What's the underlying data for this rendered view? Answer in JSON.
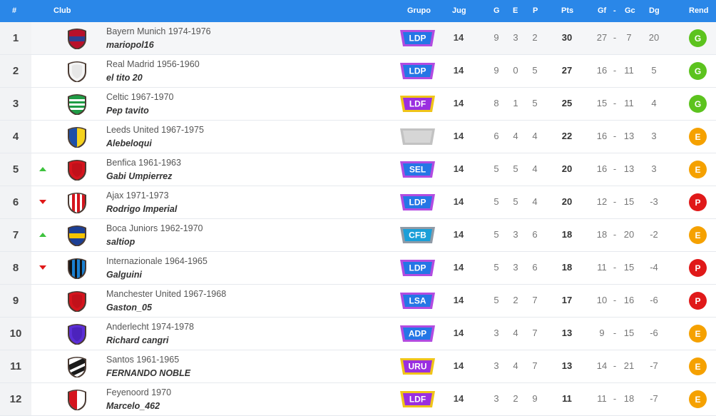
{
  "header": {
    "pos": "#",
    "club": "Club",
    "grupo": "Grupo",
    "jug": "Jug",
    "g": "G",
    "e": "E",
    "p": "P",
    "pts": "Pts",
    "gf": "Gf",
    "sep": "-",
    "gc": "Gc",
    "dg": "Dg",
    "rend": "Rend"
  },
  "colors": {
    "header_bg": "#2a87e8",
    "rend_G": "#5cc31e",
    "rend_E": "#f5a100",
    "rend_P": "#e01919",
    "trend_up": "#3ec23e",
    "trend_down": "#e01919"
  },
  "badge_colors": {
    "LDP": {
      "fill": "#2476e6",
      "rim": "#b24be0"
    },
    "LDF": {
      "fill": "#9a2ee0",
      "rim": "#f0c419"
    },
    "SEL": {
      "fill": "#2476e6",
      "rim": "#b24be0"
    },
    "CFB": {
      "fill": "#1a9fd8",
      "rim": "#8f9aa6"
    },
    "LSA": {
      "fill": "#2476e6",
      "rim": "#b24be0"
    },
    "ADP": {
      "fill": "#2476e6",
      "rim": "#b24be0"
    },
    "URU": {
      "fill": "#9a2ee0",
      "rim": "#f0c419"
    },
    "": {
      "fill": "#d6d6d6",
      "rim": "#c2c2c2"
    }
  },
  "rows": [
    {
      "pos": "1",
      "trend": "",
      "club": "Bayern Munich 1974-1976",
      "manager": "mariopol16",
      "crest": "red-blue-crest-icon",
      "crest_colors": [
        "#b8102a",
        "#2d3f8f"
      ],
      "grupo": "LDP",
      "jug": "14",
      "g": "9",
      "e": "3",
      "p": "2",
      "pts": "30",
      "gf": "27",
      "sep": "-",
      "gc": "7",
      "dg": "20",
      "rend": "G"
    },
    {
      "pos": "2",
      "trend": "",
      "club": "Real Madrid 1956-1960",
      "manager": "el tito 20",
      "crest": "white-crest-icon",
      "crest_colors": [
        "#f4f4f4",
        "#dcdcdc"
      ],
      "grupo": "LDP",
      "jug": "14",
      "g": "9",
      "e": "0",
      "p": "5",
      "pts": "27",
      "gf": "16",
      "sep": "-",
      "gc": "11",
      "dg": "5",
      "rend": "G"
    },
    {
      "pos": "3",
      "trend": "",
      "club": "Celtic 1967-1970",
      "manager": "Pep tavito",
      "crest": "green-hoops-crest-icon",
      "crest_colors": [
        "#1f9b45",
        "#ffffff"
      ],
      "grupo": "LDF",
      "jug": "14",
      "g": "8",
      "e": "1",
      "p": "5",
      "pts": "25",
      "gf": "15",
      "sep": "-",
      "gc": "11",
      "dg": "4",
      "rend": "G"
    },
    {
      "pos": "4",
      "trend": "",
      "club": "Leeds United 1967-1975",
      "manager": "Alebeloqui",
      "crest": "blue-yellow-crest-icon",
      "crest_colors": [
        "#1d4fa8",
        "#f5d21d"
      ],
      "grupo": "",
      "jug": "14",
      "g": "6",
      "e": "4",
      "p": "4",
      "pts": "22",
      "gf": "16",
      "sep": "-",
      "gc": "13",
      "dg": "3",
      "rend": "E"
    },
    {
      "pos": "5",
      "trend": "up",
      "club": "Benfica 1961-1963",
      "manager": "Gabi Umpierrez",
      "crest": "red-crest-icon",
      "crest_colors": [
        "#d5141d",
        "#b00f17"
      ],
      "grupo": "SEL",
      "jug": "14",
      "g": "5",
      "e": "5",
      "p": "4",
      "pts": "20",
      "gf": "16",
      "sep": "-",
      "gc": "13",
      "dg": "3",
      "rend": "E"
    },
    {
      "pos": "6",
      "trend": "down",
      "club": "Ajax 1971-1973",
      "manager": "Rodrigo Imperial",
      "crest": "red-white-stripe-crest-icon",
      "crest_colors": [
        "#d5141d",
        "#ffffff"
      ],
      "grupo": "LDP",
      "jug": "14",
      "g": "5",
      "e": "5",
      "p": "4",
      "pts": "20",
      "gf": "12",
      "sep": "-",
      "gc": "15",
      "dg": "-3",
      "rend": "P"
    },
    {
      "pos": "7",
      "trend": "up",
      "club": "Boca Juniors 1962-1970",
      "manager": "saltiop",
      "crest": "blue-gold-band-crest-icon",
      "crest_colors": [
        "#1c3f94",
        "#f5c400"
      ],
      "grupo": "CFB",
      "jug": "14",
      "g": "5",
      "e": "3",
      "p": "6",
      "pts": "18",
      "gf": "18",
      "sep": "-",
      "gc": "20",
      "dg": "-2",
      "rend": "E"
    },
    {
      "pos": "8",
      "trend": "down",
      "club": "Internazionale 1964-1965",
      "manager": "Galguini",
      "crest": "blue-black-stripes-crest-icon",
      "crest_colors": [
        "#1a7fd0",
        "#111111"
      ],
      "grupo": "LDP",
      "jug": "14",
      "g": "5",
      "e": "3",
      "p": "6",
      "pts": "18",
      "gf": "11",
      "sep": "-",
      "gc": "15",
      "dg": "-4",
      "rend": "P"
    },
    {
      "pos": "9",
      "trend": "",
      "club": "Manchester United 1967-1968",
      "manager": "Gaston_05",
      "crest": "red-crest-icon",
      "crest_colors": [
        "#d5141d",
        "#b00f17"
      ],
      "grupo": "LSA",
      "jug": "14",
      "g": "5",
      "e": "2",
      "p": "7",
      "pts": "17",
      "gf": "10",
      "sep": "-",
      "gc": "16",
      "dg": "-6",
      "rend": "P"
    },
    {
      "pos": "10",
      "trend": "",
      "club": "Anderlecht 1974-1978",
      "manager": "Richard cangri",
      "crest": "purple-crest-icon",
      "crest_colors": [
        "#5b2ed6",
        "#3f1ca8"
      ],
      "grupo": "ADP",
      "jug": "14",
      "g": "3",
      "e": "4",
      "p": "7",
      "pts": "13",
      "gf": "9",
      "sep": "-",
      "gc": "15",
      "dg": "-6",
      "rend": "E"
    },
    {
      "pos": "11",
      "trend": "",
      "club": "Santos 1961-1965",
      "manager": "FERNANDO NOBLE",
      "crest": "black-white-diagonal-crest-icon",
      "crest_colors": [
        "#1a1a1a",
        "#ffffff"
      ],
      "grupo": "URU",
      "jug": "14",
      "g": "3",
      "e": "4",
      "p": "7",
      "pts": "13",
      "gf": "14",
      "sep": "-",
      "gc": "21",
      "dg": "-7",
      "rend": "E"
    },
    {
      "pos": "12",
      "trend": "",
      "club": "Feyenoord 1970",
      "manager": "Marcelo_462",
      "crest": "red-white-half-crest-icon",
      "crest_colors": [
        "#d5141d",
        "#ffffff"
      ],
      "grupo": "LDF",
      "jug": "14",
      "g": "3",
      "e": "2",
      "p": "9",
      "pts": "11",
      "gf": "11",
      "sep": "-",
      "gc": "18",
      "dg": "-7",
      "rend": "E"
    }
  ]
}
